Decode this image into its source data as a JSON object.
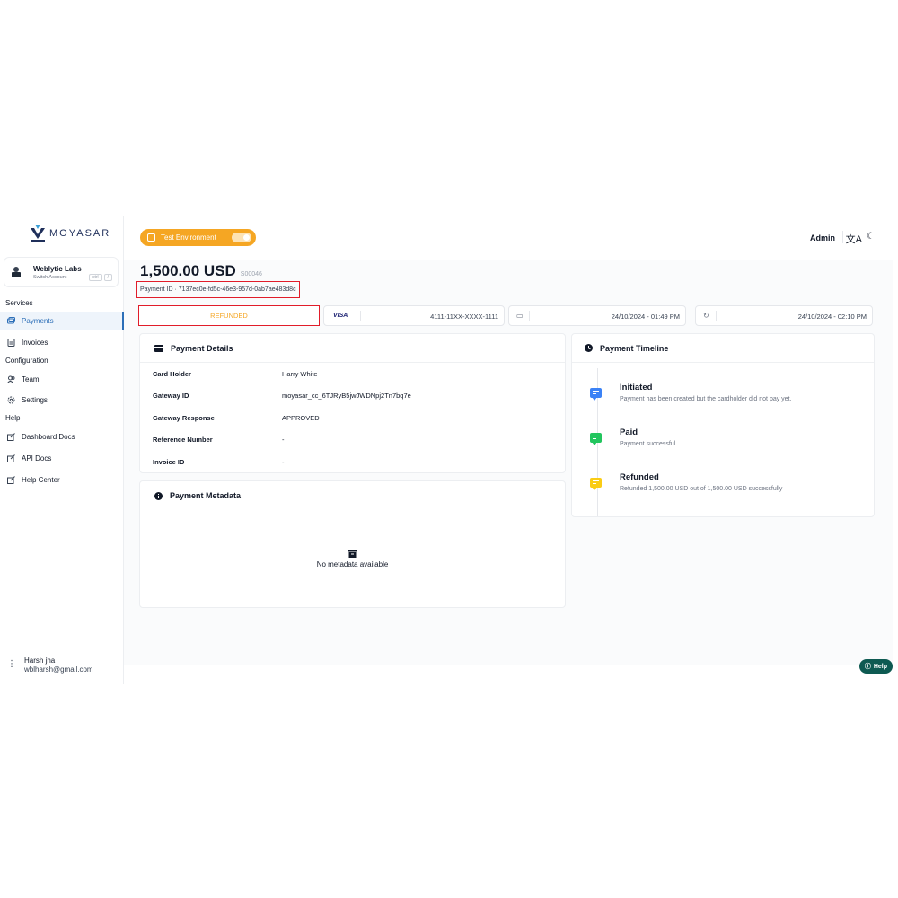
{
  "brand": {
    "logo_text": "MOYASAR"
  },
  "account": {
    "name": "Weblytic Labs",
    "subtitle": "Switch Account",
    "shortcut": [
      "ctrl",
      "/"
    ]
  },
  "sidebar": {
    "sections": {
      "services": "Services",
      "configuration": "Configuration",
      "help": "Help"
    },
    "items": [
      {
        "label": "Payments",
        "icon": "payments-icon",
        "active": true
      },
      {
        "label": "Invoices",
        "icon": "invoice-icon"
      },
      {
        "label": "Team",
        "icon": "team-icon"
      },
      {
        "label": "Settings",
        "icon": "gear-icon"
      },
      {
        "label": "Dashboard Docs",
        "icon": "external-link-icon"
      },
      {
        "label": "API Docs",
        "icon": "external-link-icon"
      },
      {
        "label": "Help Center",
        "icon": "external-link-icon"
      }
    ]
  },
  "user": {
    "name": "Harsh jha",
    "email": "wblharsh@gmail.com"
  },
  "topbar": {
    "env_label": "Test Environment",
    "env_toggle_on": true,
    "admin_label": "Admin"
  },
  "payment": {
    "amount": "1,500.00 USD",
    "code": "S00046",
    "id_text": "Payment ID · 7137ec0e-fd5c-46e3-957d-0ab7ae483d8c",
    "status": "REFUNDED",
    "card_brand": "VISA",
    "card_number": "4111-11XX-XXXX-1111",
    "created_at": "24/10/2024 - 01:49 PM",
    "updated_at": "24/10/2024 - 02:10 PM"
  },
  "details": {
    "title": "Payment Details",
    "rows": [
      {
        "label": "Card Holder",
        "value": "Harry White"
      },
      {
        "label": "Gateway ID",
        "value": "moyasar_cc_6TJRyB5jwJWDNpj2Tn7bq7e"
      },
      {
        "label": "Gateway Response",
        "value": "APPROVED"
      },
      {
        "label": "Reference Number",
        "value": "-"
      },
      {
        "label": "Invoice ID",
        "value": "-"
      }
    ]
  },
  "metadata": {
    "title": "Payment Metadata",
    "empty_text": "No metadata available"
  },
  "timeline": {
    "title": "Payment Timeline",
    "items": [
      {
        "title": "Initiated",
        "desc": "Payment has been created but the cardholder did not pay yet.",
        "color": "#3b82f6"
      },
      {
        "title": "Paid",
        "desc": "Payment successful",
        "color": "#22c55e"
      },
      {
        "title": "Refunded",
        "desc": "Refunded 1,500.00 USD out of 1,500.00 USD successfully",
        "color": "#facc15"
      }
    ]
  },
  "help": {
    "label": "Help"
  },
  "colors": {
    "accent": "#2d6fb8",
    "warning": "#f5a623",
    "highlight": "#e11d2a",
    "help_bg": "#0e5a52"
  }
}
